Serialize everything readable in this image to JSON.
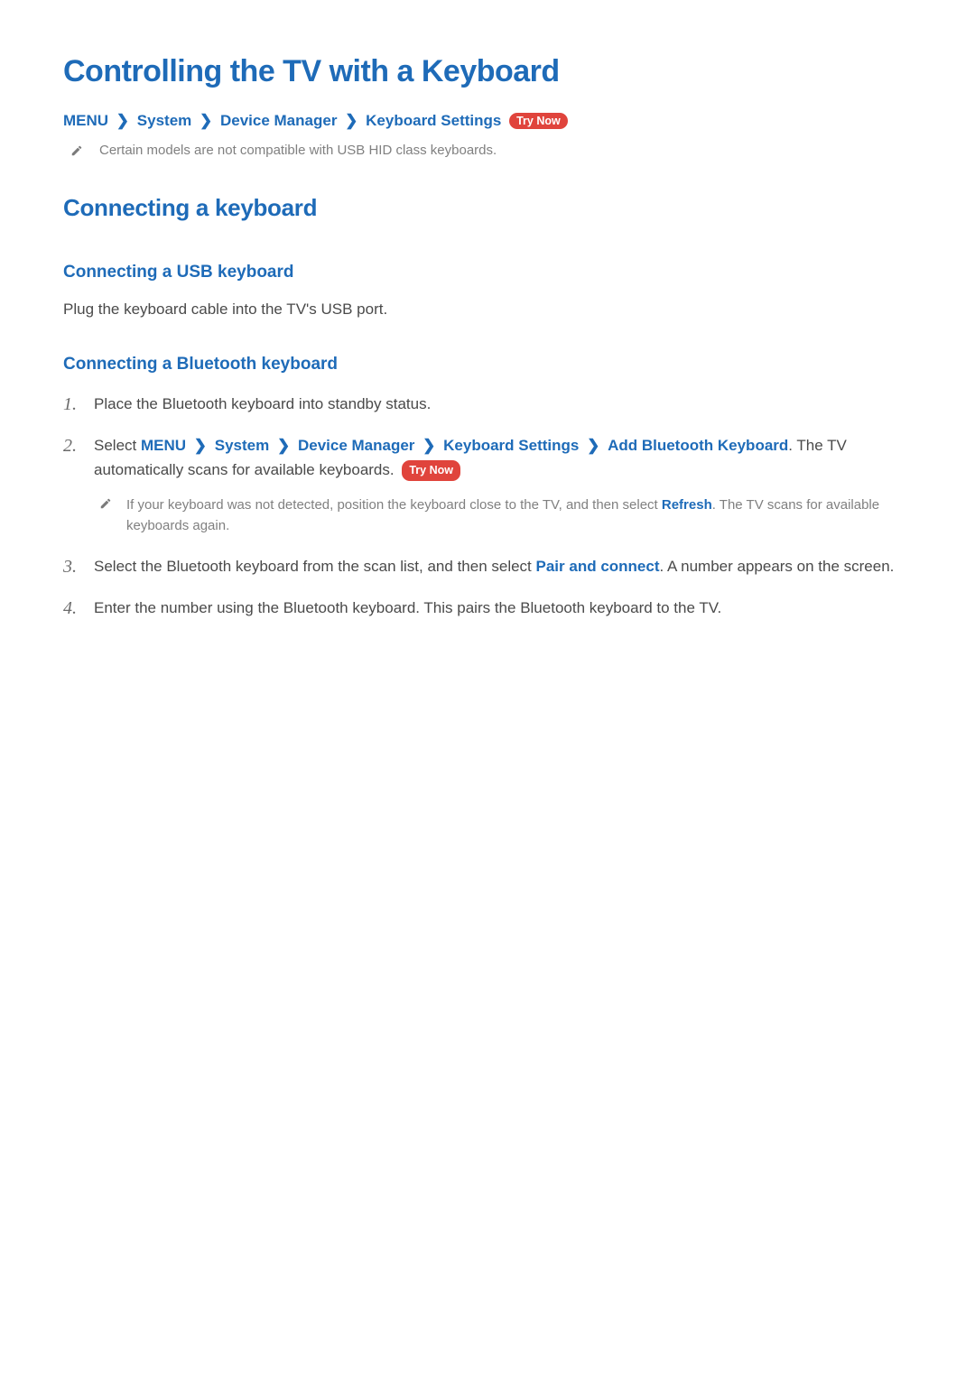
{
  "title": "Controlling the TV with a Keyboard",
  "breadcrumb_top": [
    "MENU",
    "System",
    "Device Manager",
    "Keyboard Settings"
  ],
  "try_now_label": "Try Now",
  "top_note": "Certain models are not compatible with USB HID class keyboards.",
  "section_title": "Connecting a keyboard",
  "usb": {
    "title": "Connecting a USB keyboard",
    "body": "Plug the keyboard cable into the TV's USB port."
  },
  "bluetooth": {
    "title": "Connecting a Bluetooth keyboard",
    "steps": {
      "1": "Place the Bluetooth keyboard into standby status.",
      "2": {
        "prefix": "Select ",
        "breadcrumbs": [
          "MENU",
          "System",
          "Device Manager",
          "Keyboard Settings",
          "Add Bluetooth Keyboard"
        ],
        "suffix": ". The TV automatically scans for available keyboards. ",
        "note_pre": "If your keyboard was not detected, position the keyboard close to the TV, and then select ",
        "note_highlight": "Refresh",
        "note_post": ". The TV scans for available keyboards again."
      },
      "3": {
        "pre": "Select the Bluetooth keyboard from the scan list, and then select ",
        "highlight": "Pair and connect",
        "post": ". A number appears on the screen."
      },
      "4": "Enter the number using the Bluetooth keyboard. This pairs the Bluetooth keyboard to the TV."
    }
  }
}
